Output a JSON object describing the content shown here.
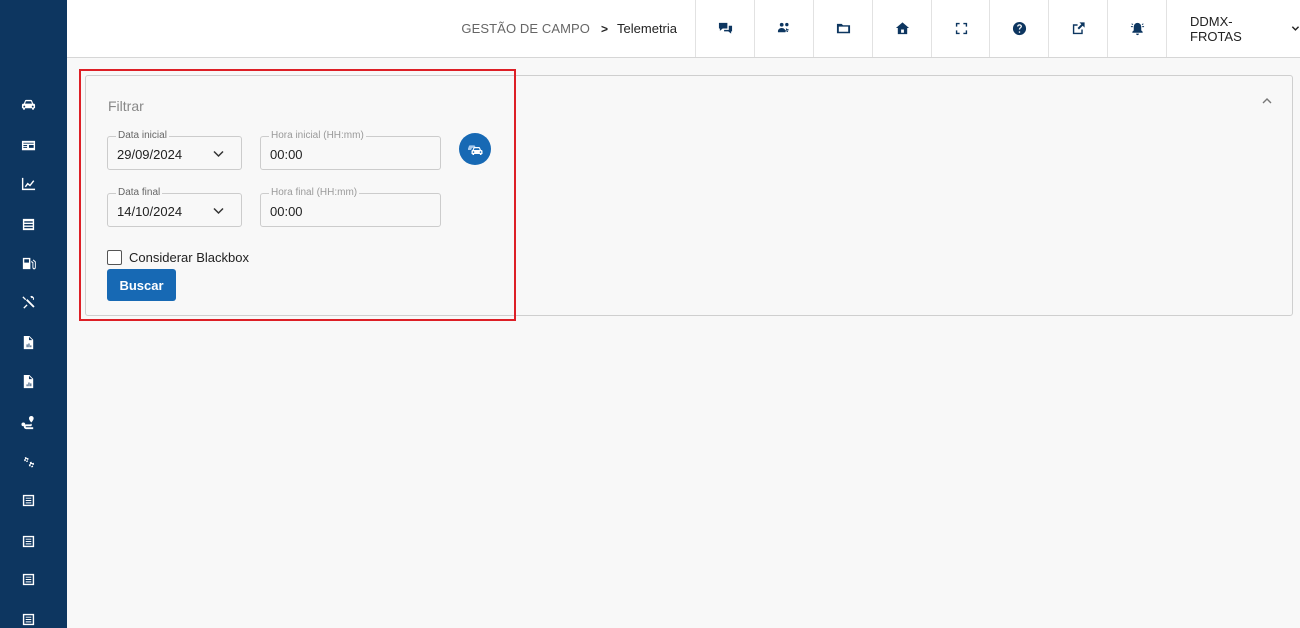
{
  "sidebar": {
    "items": [
      {
        "icon": "car-icon"
      },
      {
        "icon": "id-card-icon"
      },
      {
        "icon": "chart-line-icon"
      },
      {
        "icon": "table-icon"
      },
      {
        "icon": "fuel-icon"
      },
      {
        "icon": "tools-icon"
      },
      {
        "icon": "report-file-icon"
      },
      {
        "icon": "report-chart-file-icon"
      },
      {
        "icon": "route-icon"
      },
      {
        "icon": "gears-icon"
      },
      {
        "icon": "list-icon"
      },
      {
        "icon": "list-icon"
      },
      {
        "icon": "list-icon"
      },
      {
        "icon": "list-icon"
      }
    ]
  },
  "header": {
    "breadcrumb": {
      "section": "GESTÃO DE CAMPO",
      "separator": ">",
      "current": "Telemetria"
    },
    "buttons": [
      {
        "icon": "chat-icon"
      },
      {
        "icon": "users-cog-icon"
      },
      {
        "icon": "folder-icon"
      },
      {
        "icon": "home-icon"
      },
      {
        "icon": "fullscreen-icon"
      },
      {
        "icon": "help-icon"
      },
      {
        "icon": "external-link-icon"
      },
      {
        "icon": "alarm-bell-icon"
      }
    ],
    "user": "DDMX-FROTAS"
  },
  "filter": {
    "title": "Filtrar",
    "start_date_label": "Data inicial",
    "start_date": "29/09/2024",
    "start_time_label": "Hora inicial (HH:mm)",
    "start_time": "00:00",
    "end_date_label": "Data final",
    "end_date": "14/10/2024",
    "end_time_label": "Hora final (HH:mm)",
    "end_time": "00:00",
    "blackbox_label": "Considerar Blackbox",
    "blackbox_checked": false,
    "search_label": "Buscar"
  },
  "colors": {
    "sidebar": "#0d3660",
    "primary": "#1769b4",
    "highlight": "#dd1f26"
  }
}
